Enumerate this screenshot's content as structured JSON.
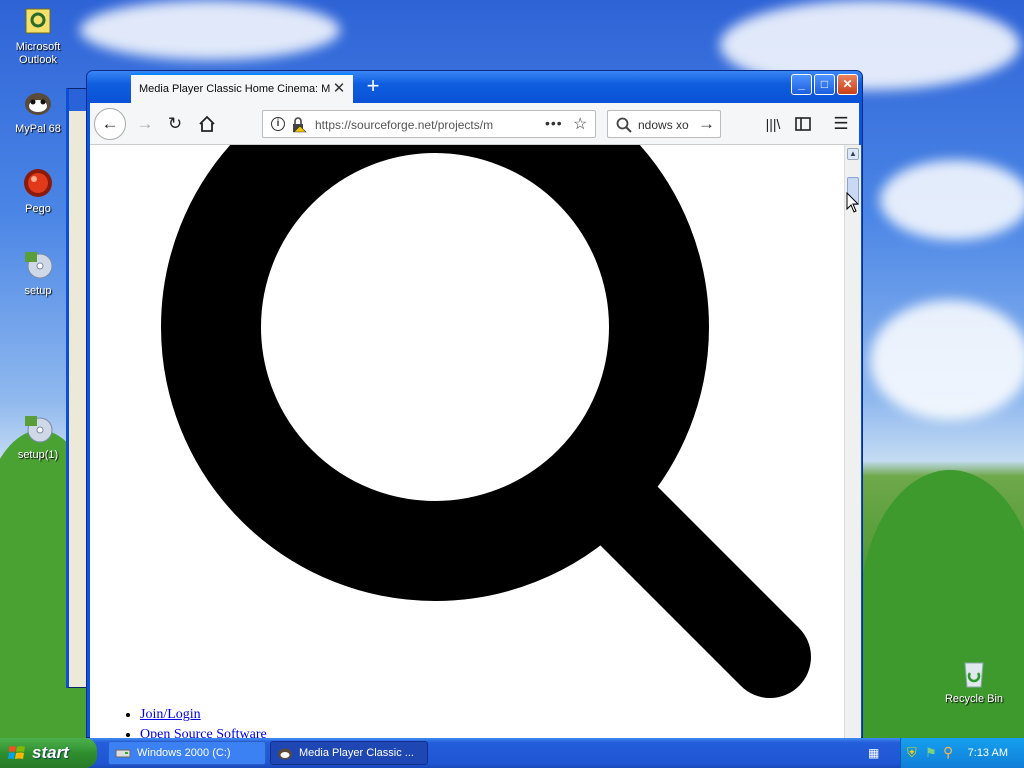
{
  "desktop": {
    "icons": [
      {
        "label": "Microsoft Outlook",
        "icon": "outlook-icon"
      },
      {
        "label": "MyPal 68",
        "icon": "mypal-icon"
      },
      {
        "label": "Pego",
        "icon": "pego-icon"
      },
      {
        "label": "setup",
        "icon": "setup-icon"
      },
      {
        "label": "setup(1)",
        "icon": "setup-icon"
      },
      {
        "label": "Recycle Bin",
        "icon": "recycle-bin-icon"
      }
    ]
  },
  "browser": {
    "tab_title": "Media Player Classic Home Cinema: MPC",
    "url": "https://sourceforge.net/projects/m",
    "search_value": "ndows xo",
    "nav_links": [
      "Join/Login",
      "Open Source Software"
    ]
  },
  "taskbar": {
    "start_label": "start",
    "items": [
      {
        "label": "Windows 2000 (C:)",
        "state": "inactive"
      },
      {
        "label": "Media Player Classic ...",
        "state": "active"
      }
    ],
    "clock": "7:13 AM"
  },
  "colors": {
    "title_blue": "#0a56e0",
    "link_blue": "#0000ee",
    "start_green": "#2f8f2f"
  }
}
